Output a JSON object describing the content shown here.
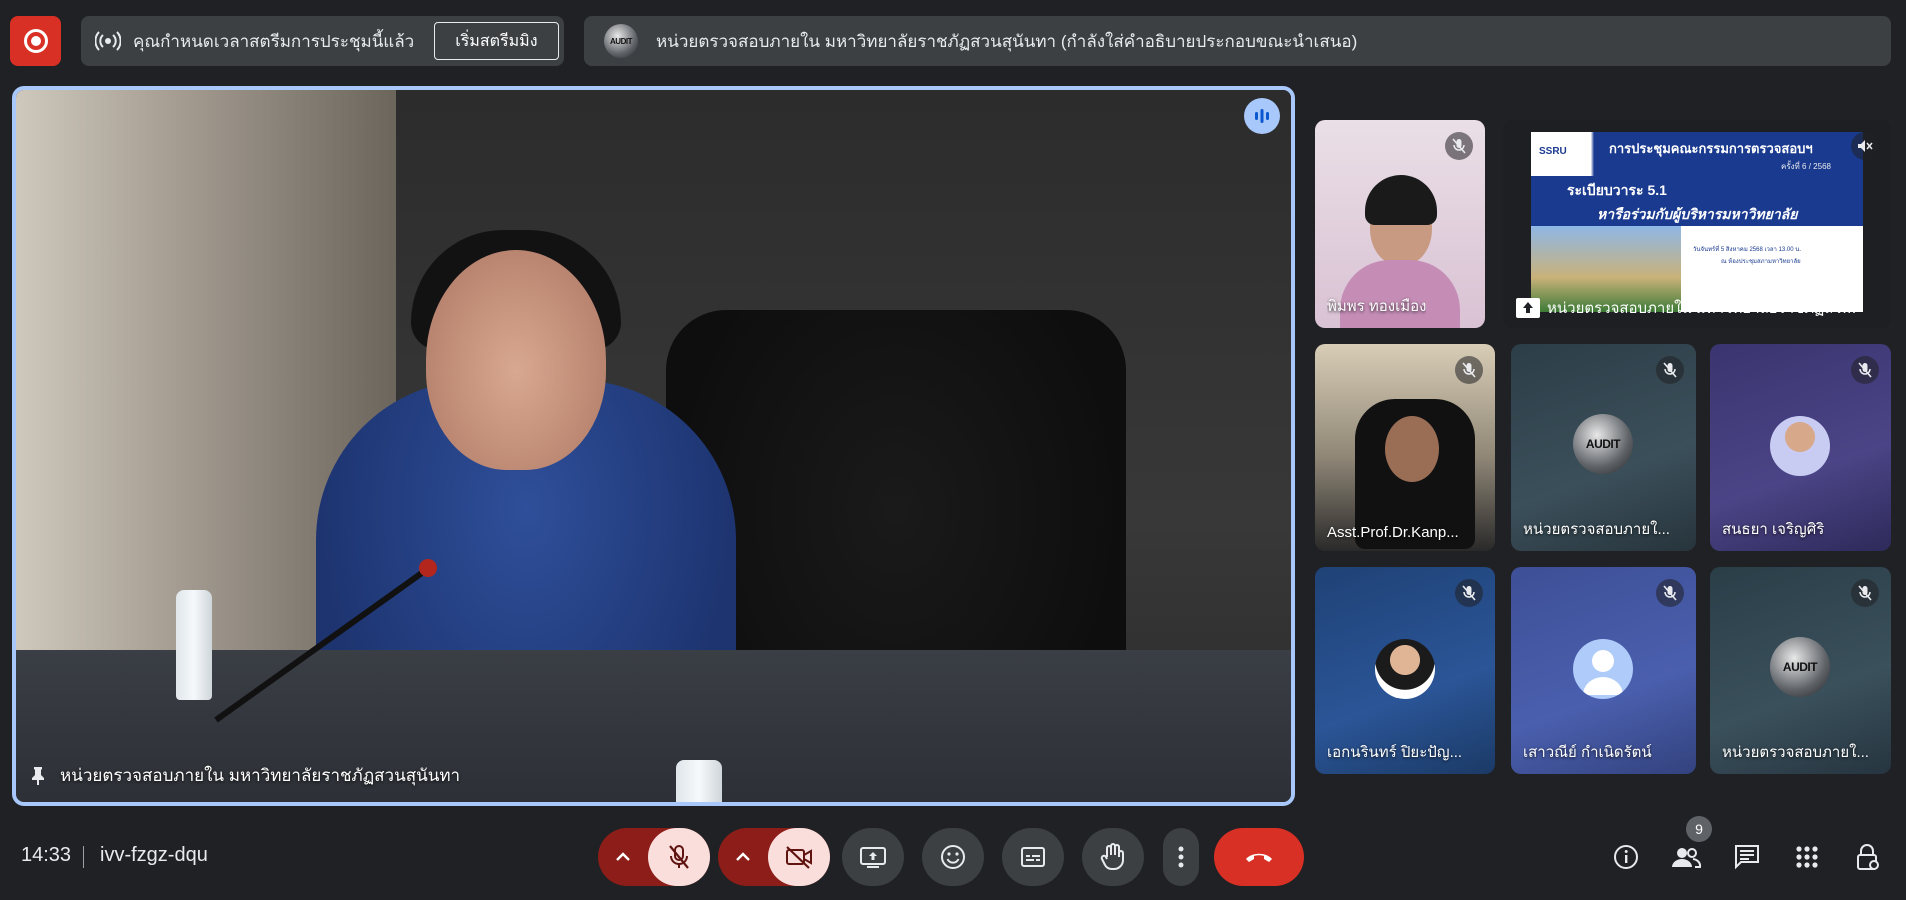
{
  "top_bar": {
    "record_button_icon": "record-icon",
    "banner_icon": "broadcast-icon",
    "banner_text": "คุณกำหนดเวลาสตรีมการประชุมนี้แล้ว",
    "start_stream_label": "เริ่มสตรีมมิง",
    "presenter_logo_text": "AUDIT",
    "presenter_text": "หน่วยตรวจสอบภายใน มหาวิทยาลัยราชภัฏสวนสุนันทา (กำลังใส่คำอธิบายประกอบขณะนำเสนอ)"
  },
  "main_tile": {
    "pin_icon": "pin-icon",
    "label": "หน่วยตรวจสอบภายใน มหาวิทยาลัยราชภัฏสวนสุนันทา",
    "speaking_icon": "audio-level-icon"
  },
  "participants": [
    {
      "name": "พิมพร ทองเมือง",
      "muted": true
    },
    {
      "name": "หน่วยตรวจสอบภายใน มหาวิทยาลัยราชภัฏสวนสุนัน...",
      "presenting": true
    },
    {
      "name": "Asst.Prof.Dr.Kanp...",
      "muted": true
    },
    {
      "name": "หน่วยตรวจสอบภายใ...",
      "muted": true
    },
    {
      "name": "สนธยา เจริญศิริ",
      "muted": true
    },
    {
      "name": "เอกนรินทร์ ปิยะปัญ...",
      "muted": true
    },
    {
      "name": "เสาวณีย์ กำเนิดรัตน์",
      "muted": true
    },
    {
      "name": "หน่วยตรวจสอบภายใ...",
      "muted": true
    }
  ],
  "slide": {
    "brand": "SSRU",
    "title": "การประชุมคณะกรรมการตรวจสอบฯ",
    "subtitle": "ครั้งที่ 6 / 2568",
    "agenda": "ระเบียบวาระ 5.1",
    "agenda_detail": "หารือร่วมกับผู้บริหารมหาวิทยาลัย",
    "date_line": "วันจันทร์ที่ 5 สิงหาคม 2568  เวลา 13.00 น.",
    "place_line": "ณ ห้องประชุมสภามหาวิทยาลัย"
  },
  "bottom_bar": {
    "time": "14:33",
    "meeting_code": "ivv-fzgz-dqu",
    "participant_count": "9",
    "controls": [
      "chevron-up-icon",
      "mic-off-icon",
      "chevron-up-icon",
      "camera-off-icon",
      "present-screen-icon",
      "emoji-icon",
      "captions-icon",
      "raise-hand-icon",
      "more-options-icon",
      "hang-up-icon"
    ],
    "right_controls": [
      "info-icon",
      "people-icon",
      "chat-icon",
      "activities-icon",
      "host-controls-icon"
    ]
  },
  "colors": {
    "background": "#202124",
    "active_border": "#a8c7fa",
    "hang_up": "#d93025",
    "record": "#d93025"
  }
}
